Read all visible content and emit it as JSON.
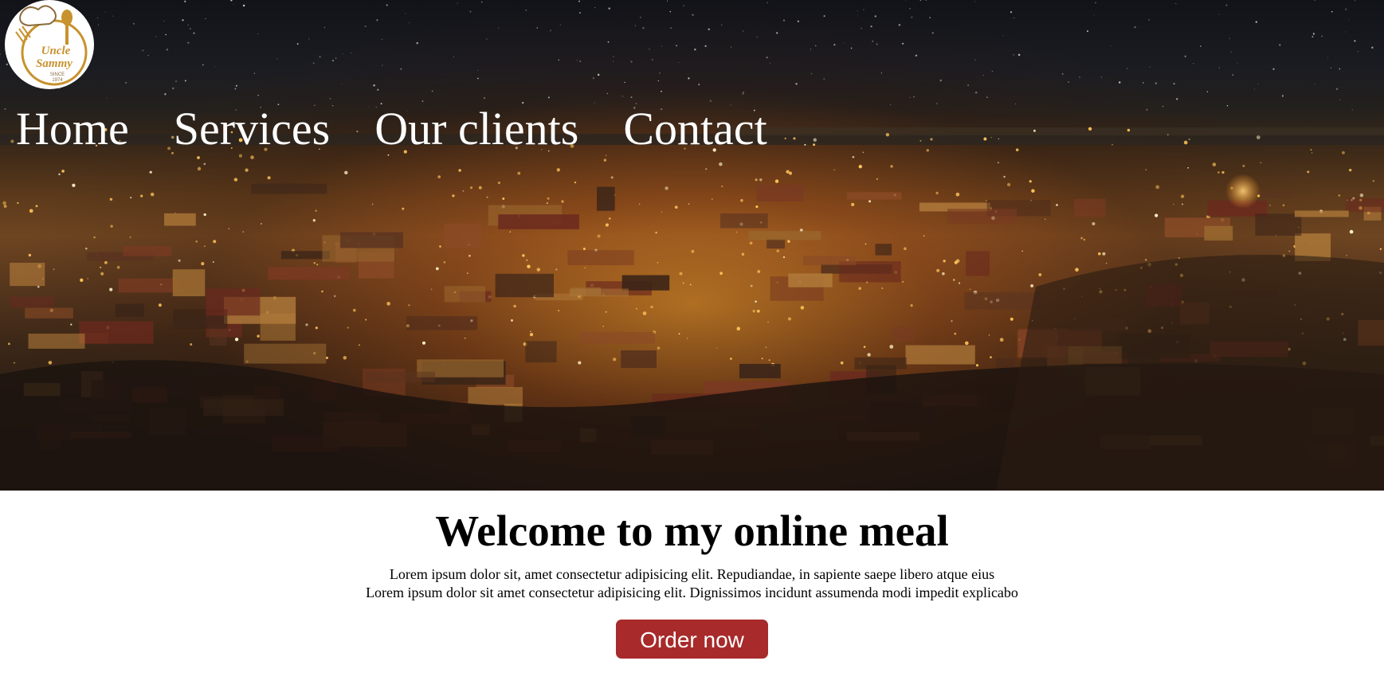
{
  "logo": {
    "name": "Uncle Sammy",
    "line1": "Uncle",
    "line2": "Sammy",
    "since": "SINCE",
    "year": "1974",
    "icon": "chef-hat-cutlery-logo"
  },
  "nav": {
    "items": [
      {
        "label": "Home"
      },
      {
        "label": "Services"
      },
      {
        "label": "Our clients"
      },
      {
        "label": "Contact"
      }
    ]
  },
  "hero": {
    "image": "night-city-skyline-photo"
  },
  "main": {
    "title": "Welcome to my online meal",
    "line1": "Lorem ipsum dolor sit, amet consectetur adipisicing elit. Repudiandae, in sapiente saepe libero atque eius",
    "line2": "Lorem ipsum dolor sit amet consectetur adipisicing elit. Dignissimos incidunt assumenda modi impedit explicabo",
    "order_label": "Order now"
  },
  "colors": {
    "order_button": "#a82a2a",
    "nav_text": "#ffffff",
    "logo_gold": "#c8922e"
  }
}
